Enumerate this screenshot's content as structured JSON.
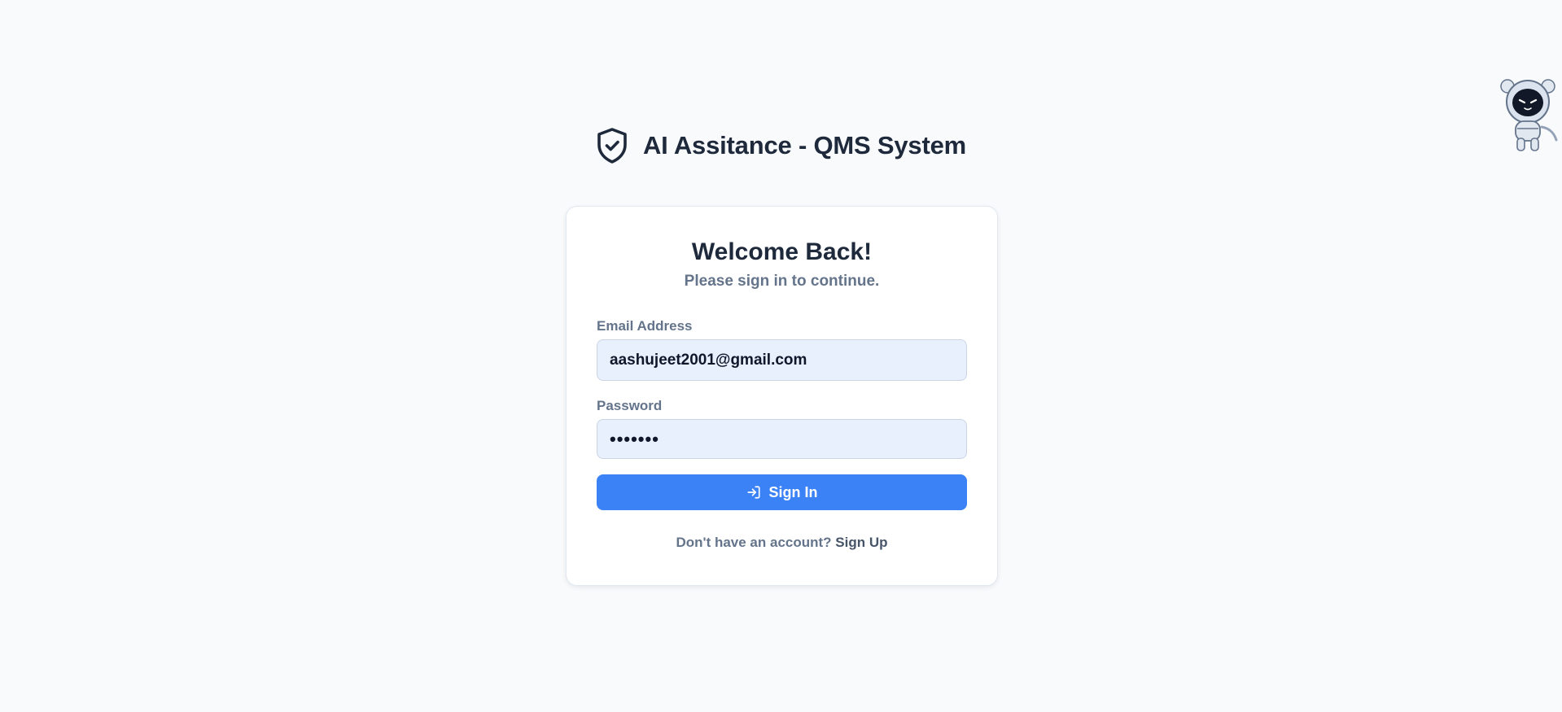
{
  "header": {
    "icon": "shield-check-icon",
    "title": "AI Assitance - QMS System"
  },
  "login_card": {
    "title": "Welcome Back!",
    "subtitle": "Please sign in to continue.",
    "email": {
      "label": "Email Address",
      "value": "aashujeet2001@gmail.com"
    },
    "password": {
      "label": "Password",
      "value": "1234567"
    },
    "submit": {
      "icon": "log-in-icon",
      "label": "Sign In"
    },
    "signup": {
      "prompt": "Don't have an account? ",
      "link_label": "Sign Up"
    }
  },
  "mascot": {
    "icon": "cat-astronaut-mascot-icon"
  },
  "colors": {
    "background": "#f8fafc",
    "primary": "#3b82f6",
    "text_dark": "#1e293b",
    "text_muted": "#64748b",
    "input_fill": "#e8f0fe"
  }
}
